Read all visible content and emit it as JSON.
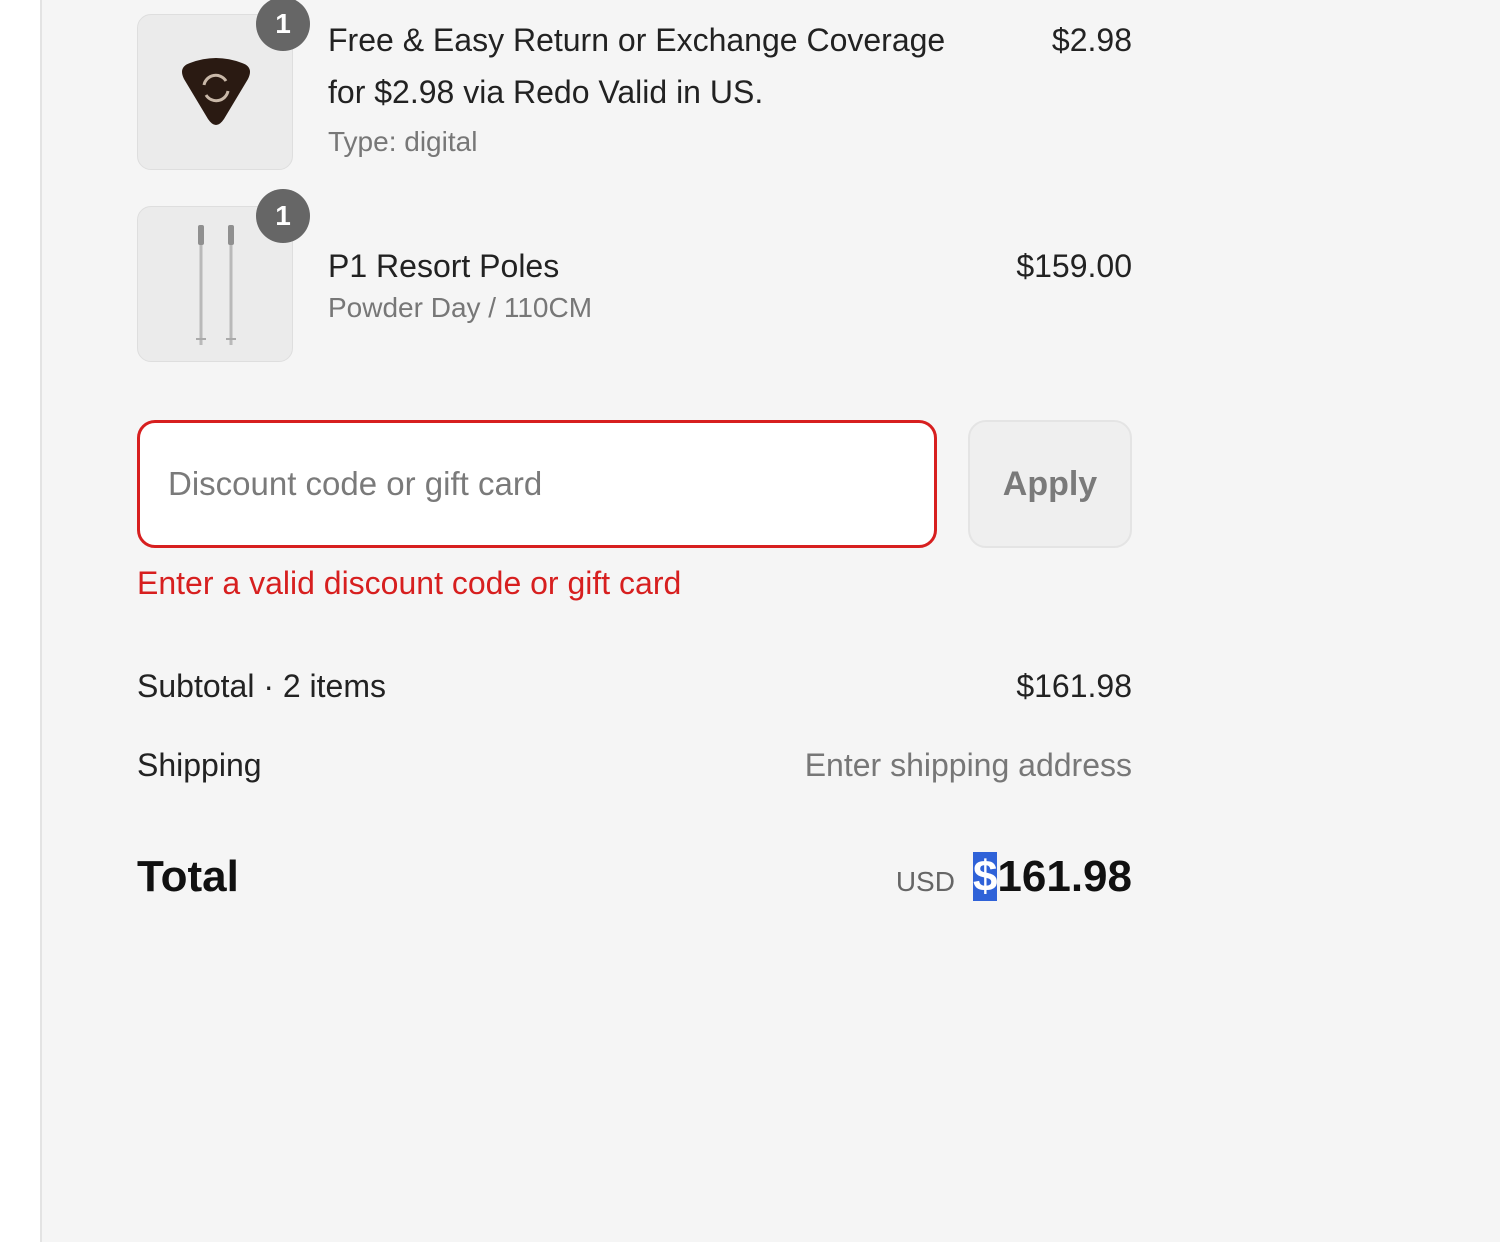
{
  "cart": {
    "items": [
      {
        "quantity": "1",
        "title_line1": "Free & Easy Return or Exchange Coverage",
        "title_line2": "for $2.98 via Redo Valid in US.",
        "subtitle": "Type: digital",
        "price": "$2.98",
        "icon": "return-shield-icon"
      },
      {
        "quantity": "1",
        "title_line1": "P1 Resort Poles",
        "subtitle": "Powder Day / 110CM",
        "price": "$159.00",
        "icon": "ski-poles-image"
      }
    ]
  },
  "discount": {
    "placeholder": "Discount code or gift card",
    "value": "",
    "apply_label": "Apply",
    "error": "Enter a valid discount code or gift card"
  },
  "summary": {
    "subtotal_label": "Subtotal · 2 items",
    "subtotal_value": "$161.98",
    "shipping_label": "Shipping",
    "shipping_value": "Enter shipping address",
    "total_label": "Total",
    "currency": "USD",
    "total_symbol": "$",
    "total_value": "161.98"
  },
  "colors": {
    "error": "#d71f1f",
    "selection": "#2f62d8",
    "background": "#f5f5f5"
  }
}
